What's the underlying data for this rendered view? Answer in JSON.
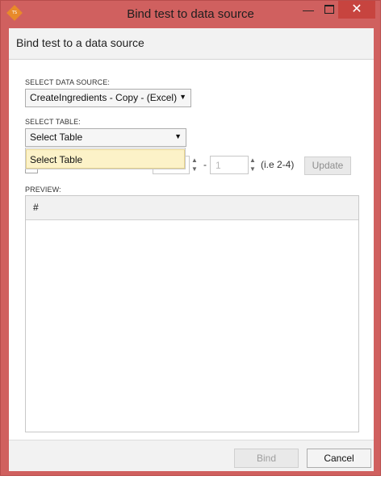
{
  "window": {
    "title": "Bind test to data source",
    "icon_text": "TS",
    "minimize_glyph": "—",
    "close_glyph": "✕"
  },
  "header": {
    "title": "Bind test to a data source"
  },
  "form": {
    "data_source_label": "SELECT DATA SOURCE:",
    "data_source_value": "CreateIngredients - Copy - (Excel)",
    "table_label": "SELECT TABLE:",
    "table_value": "Select Table",
    "table_options": [
      "Select Table"
    ],
    "row_to_value": "1",
    "range_separator": "-",
    "range_hint": "(i.e 2-4)",
    "update_label": "Update"
  },
  "preview": {
    "label": "PREVIEW:",
    "column_header": "#"
  },
  "footer": {
    "bind_label": "Bind",
    "cancel_label": "Cancel"
  },
  "colors": {
    "window_frame": "#d0605f",
    "close_button": "#c7443f",
    "dropdown_highlight": "#fcf2c8"
  }
}
